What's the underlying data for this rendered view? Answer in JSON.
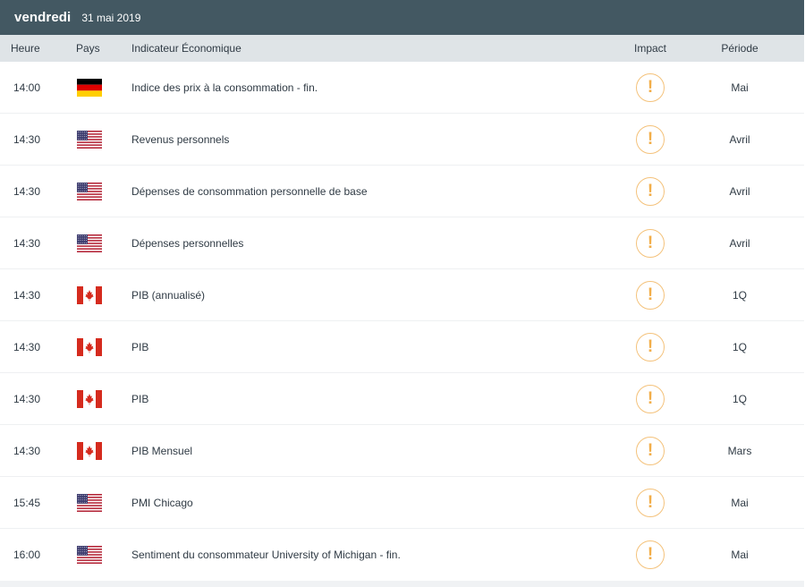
{
  "day": {
    "name": "vendredi",
    "date": "31 mai 2019"
  },
  "columns": {
    "time": "Heure",
    "country": "Pays",
    "indicator": "Indicateur Économique",
    "impact": "Impact",
    "period": "Période"
  },
  "impact_glyph": "!",
  "colors": {
    "header_bg": "#435862",
    "column_bg": "#dfe4e7",
    "impact": "#f2ae4a"
  },
  "rows": [
    {
      "time": "14:00",
      "country": "de-flag-icon",
      "indicator": "Indice des prix à la consommation - fin.",
      "period": "Mai"
    },
    {
      "time": "14:30",
      "country": "us-flag-icon",
      "indicator": "Revenus personnels",
      "period": "Avril"
    },
    {
      "time": "14:30",
      "country": "us-flag-icon",
      "indicator": "Dépenses de consommation personnelle de base",
      "period": "Avril"
    },
    {
      "time": "14:30",
      "country": "us-flag-icon",
      "indicator": "Dépenses personnelles",
      "period": "Avril"
    },
    {
      "time": "14:30",
      "country": "ca-flag-icon",
      "indicator": "PIB (annualisé)",
      "period": "1Q"
    },
    {
      "time": "14:30",
      "country": "ca-flag-icon",
      "indicator": "PIB",
      "period": "1Q"
    },
    {
      "time": "14:30",
      "country": "ca-flag-icon",
      "indicator": "PIB",
      "period": "1Q"
    },
    {
      "time": "14:30",
      "country": "ca-flag-icon",
      "indicator": "PIB Mensuel",
      "period": "Mars"
    },
    {
      "time": "15:45",
      "country": "us-flag-icon",
      "indicator": "PMI Chicago",
      "period": "Mai"
    },
    {
      "time": "16:00",
      "country": "us-flag-icon",
      "indicator": "Sentiment du consommateur University of Michigan - fin.",
      "period": "Mai"
    }
  ]
}
